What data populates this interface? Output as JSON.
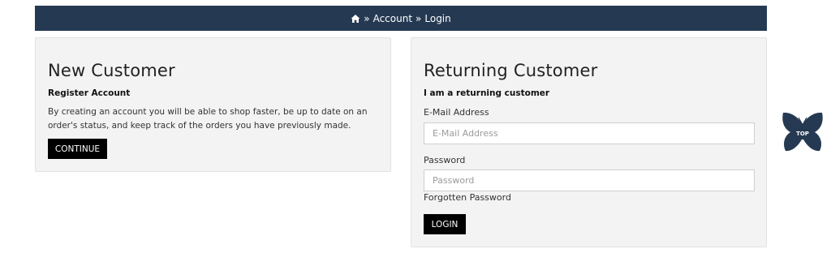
{
  "breadcrumb": {
    "separator": "»",
    "items": [
      "Account",
      "Login"
    ]
  },
  "new_customer": {
    "title": "New Customer",
    "subtitle": "Register Account",
    "description": "By creating an account you will be able to shop faster, be up to date on an order's status, and keep track of the orders you have previously made.",
    "button_label": "CONTINUE"
  },
  "returning_customer": {
    "title": "Returning Customer",
    "subtitle": "I am a returning customer",
    "email_label": "E-Mail Address",
    "email_placeholder": "E-Mail Address",
    "password_label": "Password",
    "password_placeholder": "Password",
    "forgot_label": "Forgotten Password",
    "button_label": "LOGIN"
  },
  "back_to_top": {
    "label": "TOP",
    "icon": "butterfly-icon"
  },
  "colors": {
    "breadcrumb_bg": "#253a52",
    "panel_bg": "#f3f3f3",
    "button_bg": "#000000",
    "top_icon": "#253a52"
  }
}
